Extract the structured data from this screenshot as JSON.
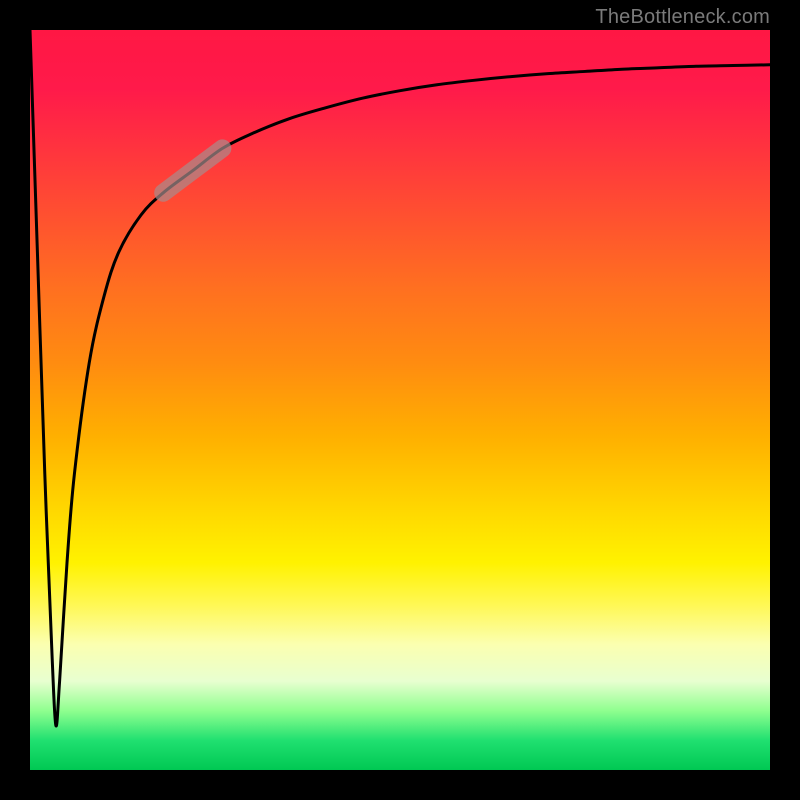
{
  "watermark": "TheBottleneck.com",
  "chart_data": {
    "type": "line",
    "title": "",
    "xlabel": "",
    "ylabel": "",
    "xlim": [
      0,
      100
    ],
    "ylim": [
      0,
      100
    ],
    "grid": false,
    "legend": false,
    "series": [
      {
        "name": "bottleneck-curve",
        "x": [
          0,
          1,
          2,
          3,
          3.5,
          4,
          5,
          6,
          8,
          10,
          12,
          15,
          18,
          22,
          26,
          30,
          35,
          40,
          45,
          50,
          55,
          60,
          65,
          70,
          75,
          80,
          85,
          90,
          95,
          100
        ],
        "y": [
          100,
          70,
          40,
          15,
          6,
          12,
          28,
          40,
          55,
          64,
          70,
          75,
          78,
          81,
          84,
          86,
          88,
          89.5,
          90.8,
          91.8,
          92.6,
          93.2,
          93.7,
          94.1,
          94.4,
          94.7,
          94.9,
          95.1,
          95.2,
          95.3
        ]
      }
    ],
    "highlight": {
      "x_range": [
        18,
        26
      ],
      "note": "semi-transparent thick grey segment overlaying the curve"
    },
    "colors": {
      "curve": "#000000",
      "highlight": "rgba(168,140,140,0.70)",
      "gradient_top": "#ff1744",
      "gradient_bottom": "#00c853"
    }
  }
}
